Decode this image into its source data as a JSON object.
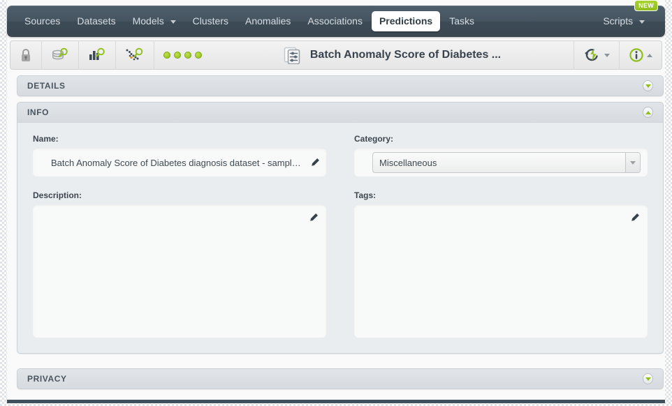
{
  "nav": {
    "items": [
      {
        "label": "Sources",
        "active": false,
        "dropdown": false
      },
      {
        "label": "Datasets",
        "active": false,
        "dropdown": false
      },
      {
        "label": "Models",
        "active": false,
        "dropdown": true
      },
      {
        "label": "Clusters",
        "active": false,
        "dropdown": false
      },
      {
        "label": "Anomalies",
        "active": false,
        "dropdown": false
      },
      {
        "label": "Associations",
        "active": false,
        "dropdown": false
      },
      {
        "label": "Predictions",
        "active": true,
        "dropdown": false
      },
      {
        "label": "Tasks",
        "active": false,
        "dropdown": false
      }
    ],
    "scripts_label": "Scripts",
    "new_badge": "NEW"
  },
  "toolbar": {
    "icons": [
      {
        "name": "lock-icon",
        "title": "Private"
      },
      {
        "name": "dataset-search-icon",
        "title": "Dataset"
      },
      {
        "name": "model-search-icon",
        "title": "Model"
      },
      {
        "name": "anomaly-search-icon",
        "title": "Anomaly detector"
      }
    ],
    "status_dots": 4,
    "title": "Batch Anomaly Score of Diabetes ...",
    "title_icon": "batch-prediction-icon",
    "action_icon": "lightning-actions-icon",
    "info_icon": "info-circle-icon"
  },
  "panels": {
    "details": {
      "title": "DETAILS",
      "expanded": false
    },
    "info": {
      "title": "INFO",
      "expanded": true
    },
    "privacy": {
      "title": "PRIVACY",
      "expanded": false
    }
  },
  "info_form": {
    "name_label": "Name:",
    "name_value": "Batch Anomaly Score of Diabetes diagnosis dataset - sample... with …",
    "category_label": "Category:",
    "category_value": "Miscellaneous",
    "description_label": "Description:",
    "description_value": "",
    "tags_label": "Tags:",
    "tags_value": ""
  },
  "colors": {
    "nav_bg": "#44535f",
    "accent_green": "#93bf1d",
    "panel_header": "#dde1e5",
    "panel_body": "#e9edf0",
    "text_dark": "#39434d"
  }
}
